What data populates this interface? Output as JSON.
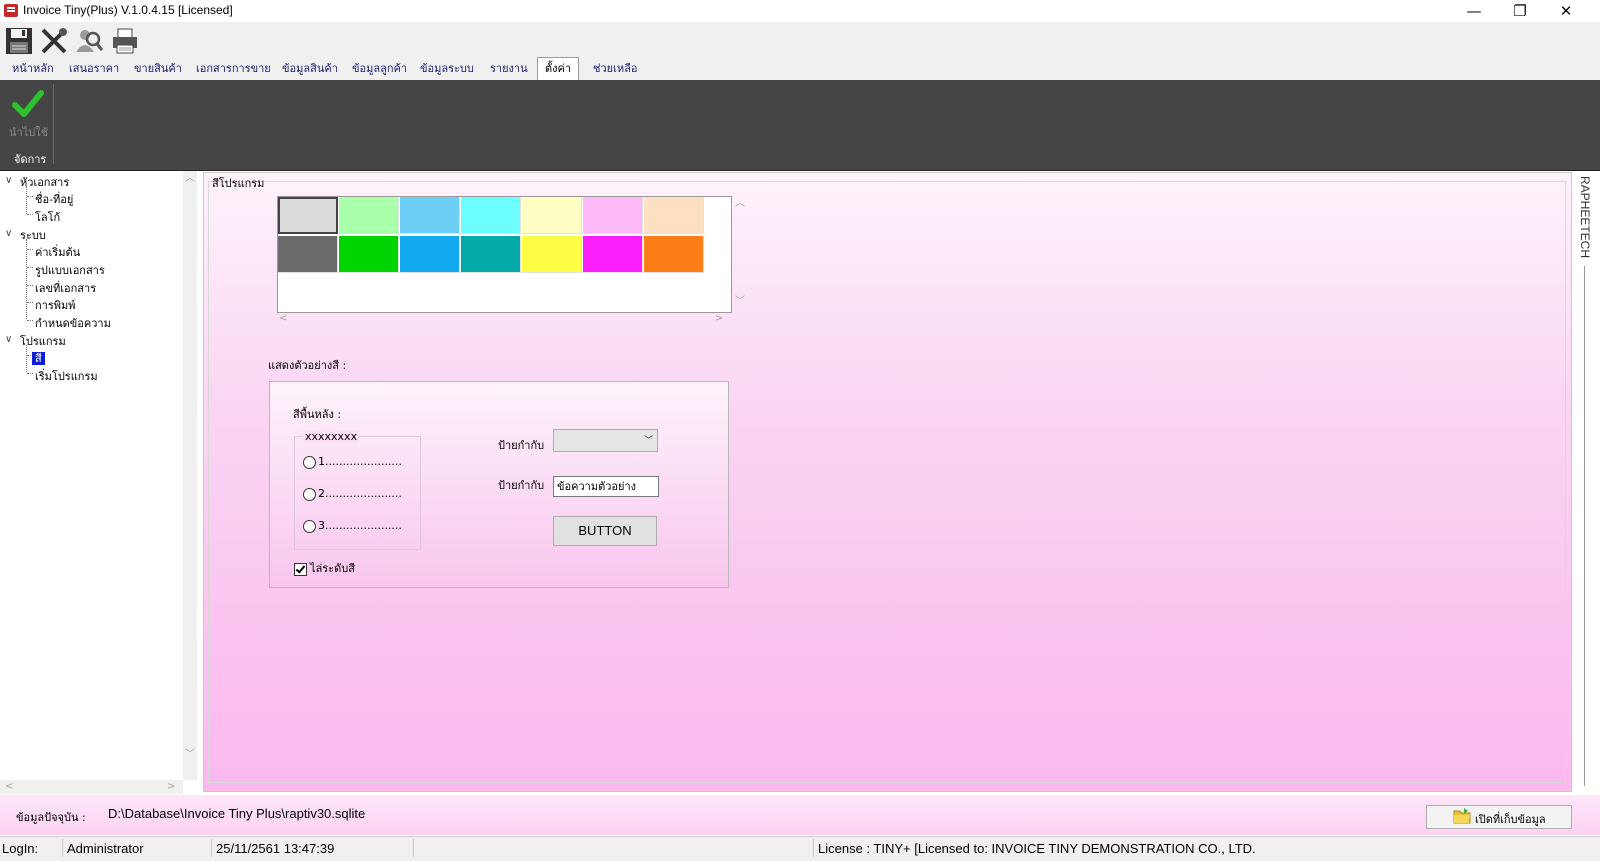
{
  "window": {
    "title": "Invoice Tiny(Plus)  V.1.0.4.15 [Licensed]",
    "minimize_glyph": "—",
    "maximize_glyph": "❐",
    "close_glyph": "✕"
  },
  "quick_toolbar": [
    "save-icon",
    "close-tools-icon",
    "search-people-icon",
    "printer-icon"
  ],
  "menu_tabs": [
    "หน้าหลัก",
    "เสนอราคา",
    "ขายสินค้า",
    "เอกสารการขาย",
    "ข้อมูลสินค้า",
    "ข้อมูลลูกค้า",
    "ข้อมูลระบบ",
    "รายงาน",
    "ตั้งค่า",
    "ช่วยเหลือ"
  ],
  "active_tab": "ตั้งค่า",
  "ribbon": {
    "apply_label": "นำไปใช้",
    "group_label": "จัดการ",
    "apply_icon": "checkmark-icon"
  },
  "tree": {
    "groups": [
      {
        "label": "หัวเอกสาร",
        "children": [
          "ชื่อ-ที่อยู่",
          "โลโก้"
        ]
      },
      {
        "label": "ระบบ",
        "children": [
          "ค่าเริ่มต้น",
          "รูปแบบเอกสาร",
          "เลขที่เอกสาร",
          "การพิมพ์",
          "กำหนดข้อความ"
        ]
      },
      {
        "label": "โปรแกรม",
        "children": [
          "สี",
          "เริ่มโปรแกรม"
        ]
      }
    ],
    "selected": "สี",
    "expand_glyph": "∨"
  },
  "panel": {
    "group_title": "สีโปรแกรม",
    "palette_row1": [
      "#dcdcdc",
      "#aaffaa",
      "#6ecff6",
      "#6dfefe",
      "#ffffc3",
      "#feb9f9",
      "#fde0c2"
    ],
    "palette_row2": [
      "#6b6b6b",
      "#00d400",
      "#12a9ee",
      "#02a9a9",
      "#fefe44",
      "#fd1efd",
      "#fd7e19"
    ],
    "preview_label": "แสดงตัวอย่างสี :",
    "bg_label": "สีพื้นหลัง :",
    "radio_group_title": "xxxxxxxx",
    "radios": [
      "1......................",
      "2......................",
      "3......................"
    ],
    "checkbox_label": "ไล่ระดับสี",
    "checkbox_checked": true,
    "field1_label": "ป้ายกำกับ",
    "field2_label": "ป้ายกำกับ",
    "combo_value": "",
    "text_value": "ข้อความตัวอย่าง",
    "button_label": "BUTTON"
  },
  "brand": "RAPHEETECH",
  "pathbar": {
    "label": "ข้อมูลปัจจุบัน :",
    "path": "D:\\Database\\Invoice Tiny Plus\\raptiv30.sqlite",
    "open_button": "เปิดที่เก็บข้อมูล"
  },
  "status": {
    "login_label": "LogIn:",
    "user": "Administrator",
    "datetime": "25/11/2561 13:47:39",
    "license": "License : TINY+ [Licensed to: INVOICE TINY DEMONSTRATION CO., LTD."
  }
}
